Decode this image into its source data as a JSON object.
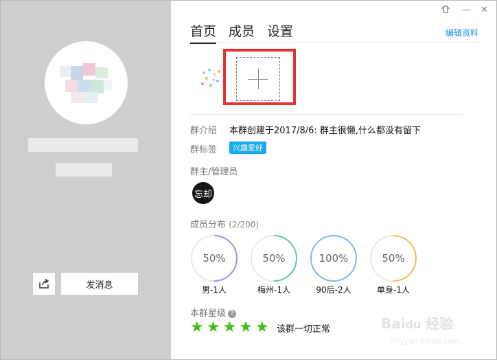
{
  "window": {
    "skin_icon": "skin-icon",
    "minimize": "—",
    "close": "✕"
  },
  "tabs": [
    {
      "label": "首页",
      "active": true
    },
    {
      "label": "成员",
      "active": false
    },
    {
      "label": "设置",
      "active": false
    }
  ],
  "edit_profile": "编辑资料",
  "left": {
    "send_message": "发消息",
    "share_icon": "share-icon"
  },
  "group": {
    "intro_label": "群介绍",
    "intro_text": "本群创建于2017/8/6: 群主很懒,什么都没有留下",
    "tag_label": "群标签",
    "tag": "兴趣爱好",
    "admin_label": "群主/管理员",
    "admin_avatar_text": "忘却",
    "distribution_label": "成员分布",
    "distribution_count": "(2/200)",
    "distribution": [
      {
        "percent": "50%",
        "fraction": 0.5,
        "label": "男-1人",
        "color": "#a98de4"
      },
      {
        "percent": "50%",
        "fraction": 0.5,
        "label": "梅州-1人",
        "color": "#5ccf9c"
      },
      {
        "percent": "100%",
        "fraction": 1.0,
        "label": "90后-2人",
        "color": "#84b6ee"
      },
      {
        "percent": "50%",
        "fraction": 0.5,
        "label": "单身-1人",
        "color": "#f1be52"
      }
    ],
    "level_label": "本群星级",
    "level_help": "?",
    "stars": 5,
    "level_text": "该群一切正常"
  },
  "watermark": {
    "brand": "Bai 经验",
    "url": "jingyan.baidu.com"
  }
}
